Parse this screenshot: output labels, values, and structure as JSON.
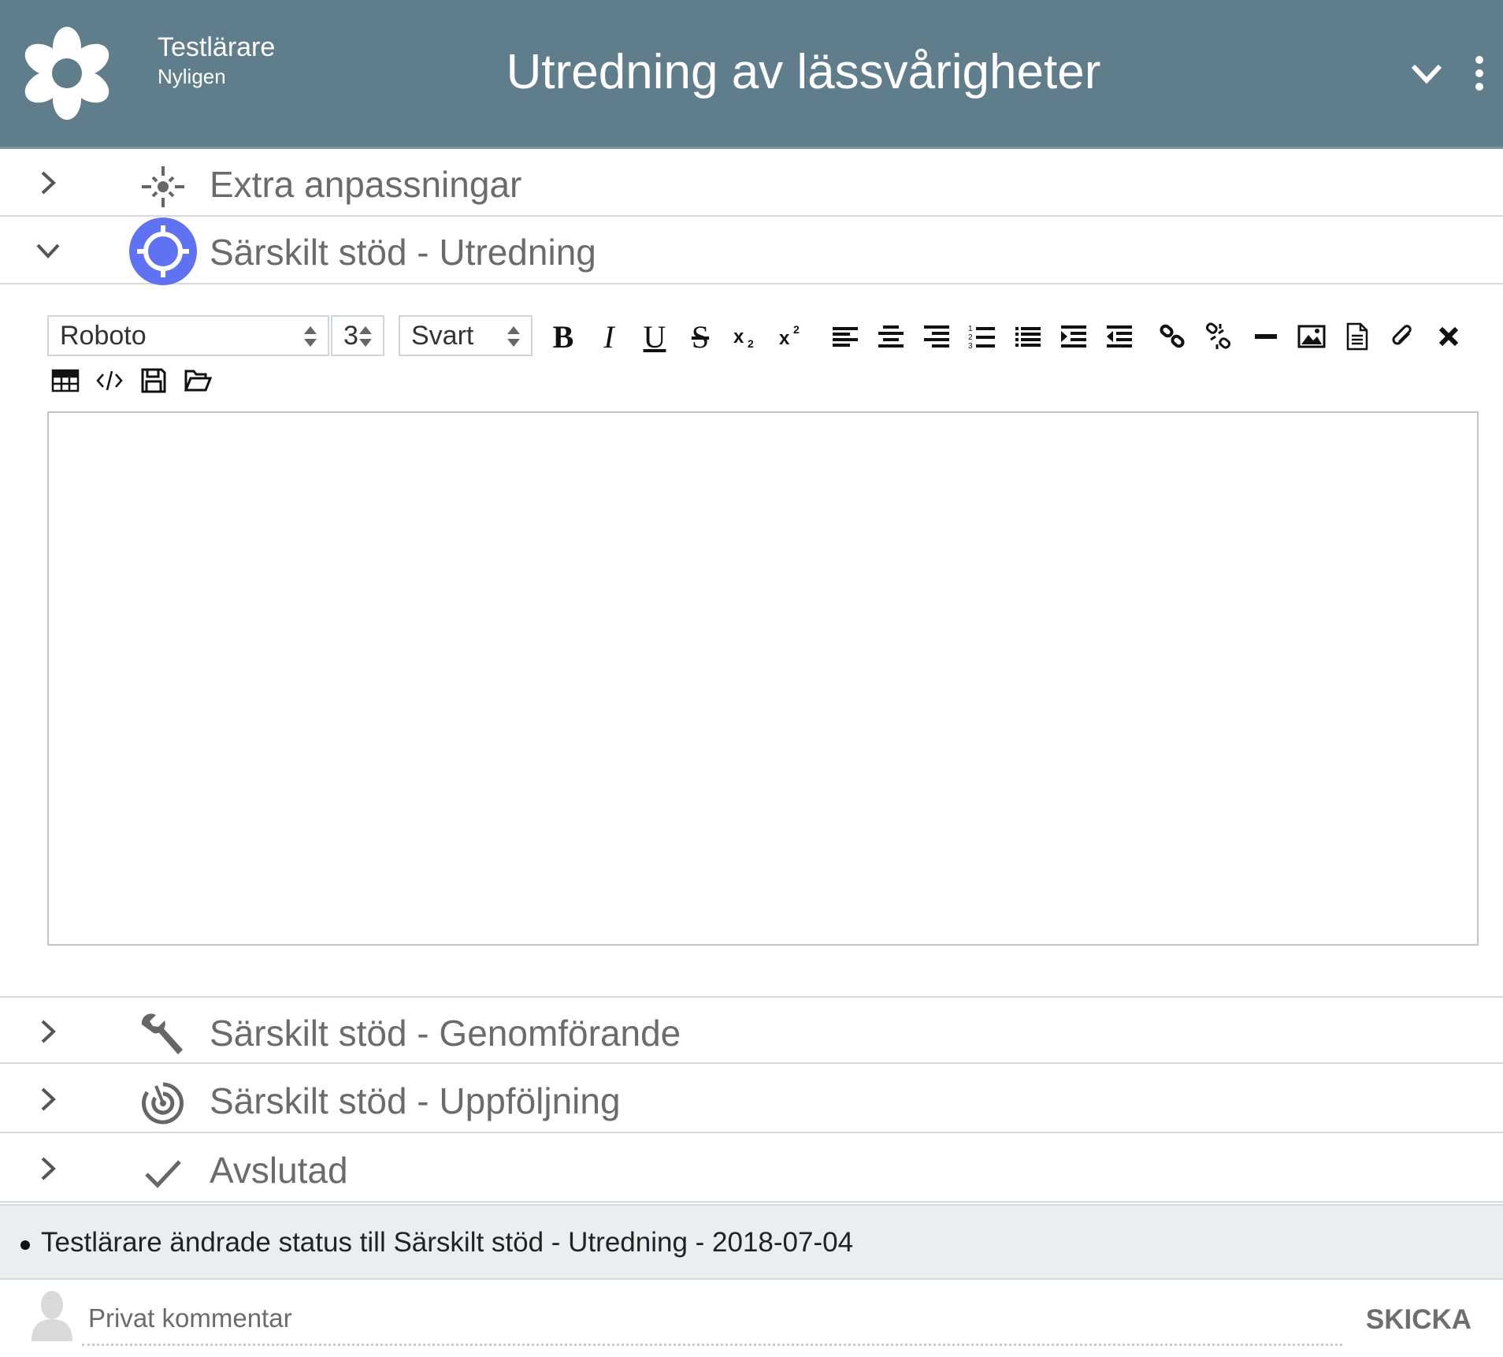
{
  "header": {
    "user_name": "Testlärare",
    "user_subtitle": "Nyligen",
    "title": "Utredning av lässvårigheter",
    "background_color": "#607d8b"
  },
  "sections": [
    {
      "label": "Extra anpassningar",
      "icon": "sparkle-icon",
      "expanded": false
    },
    {
      "label": "Särskilt stöd - Utredning",
      "icon": "crosshair-icon",
      "expanded": true,
      "accent_color": "#5f73f2"
    },
    {
      "label": "Särskilt stöd - Genomförande",
      "icon": "wrench-icon",
      "expanded": false
    },
    {
      "label": "Särskilt stöd - Uppföljning",
      "icon": "target-icon",
      "expanded": false
    },
    {
      "label": "Avslutad",
      "icon": "checkmark-icon",
      "expanded": false
    }
  ],
  "editor": {
    "font_select": "Roboto",
    "size_select": "3",
    "color_select": "Svart",
    "tools": [
      "bold",
      "italic",
      "underline",
      "strikethrough",
      "subscript",
      "superscript",
      "align-left",
      "align-center",
      "align-right",
      "ordered-list",
      "unordered-list",
      "indent",
      "outdent",
      "link",
      "unlink",
      "horizontal-rule",
      "image",
      "document",
      "attachment",
      "clear-format",
      "table",
      "code",
      "save",
      "open"
    ],
    "content": ""
  },
  "status": {
    "text": "Testlärare ändrade status till Särskilt stöd - Utredning - 2018-07-04"
  },
  "comment": {
    "placeholder": "Privat kommentar",
    "send_label": "SKICKA"
  }
}
